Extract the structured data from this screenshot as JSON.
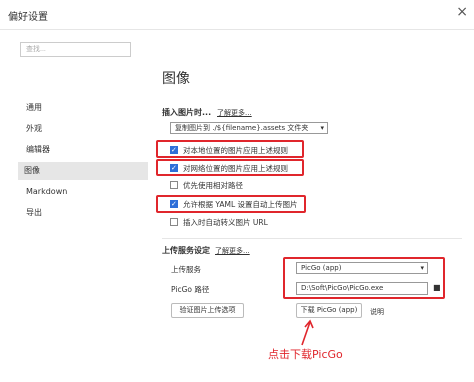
{
  "window": {
    "title": "偏好设置",
    "close": "×"
  },
  "sidebar": {
    "search_placeholder": "查找...",
    "items": [
      {
        "label": "通用"
      },
      {
        "label": "外观"
      },
      {
        "label": "编辑器"
      },
      {
        "label": "图像",
        "active": true
      },
      {
        "label": "Markdown"
      },
      {
        "label": "导出"
      }
    ]
  },
  "main": {
    "title": "图像",
    "insert": {
      "label": "插入图片时...",
      "more_link": "了解更多...",
      "action_select": "复制图片到 ./${filename}.assets 文件夹",
      "checkboxes": [
        {
          "label": "对本地位置的图片应用上述规则",
          "checked": true
        },
        {
          "label": "对网络位置的图片应用上述规则",
          "checked": true
        },
        {
          "label": "优先使用相对路径",
          "checked": false
        },
        {
          "label": "允许根据 YAML 设置自动上传图片",
          "checked": true
        },
        {
          "label": "插入时自动转义图片 URL",
          "checked": false
        }
      ]
    },
    "upload": {
      "label": "上传服务设定",
      "more_link": "了解更多...",
      "service_label": "上传服务",
      "service_value": "PicGo (app)",
      "path_label": "PicGo 路径",
      "path_value": "D:\\Soft\\PicGo\\PicGo.exe",
      "verify_button": "验证图片上传选项",
      "download_button": "下载 PicGo (app)",
      "help_link": "说明"
    },
    "annotation": "点击下载PicGo"
  },
  "colors": {
    "highlight": "#e0262c",
    "checkbox": "#2e6fd8"
  }
}
